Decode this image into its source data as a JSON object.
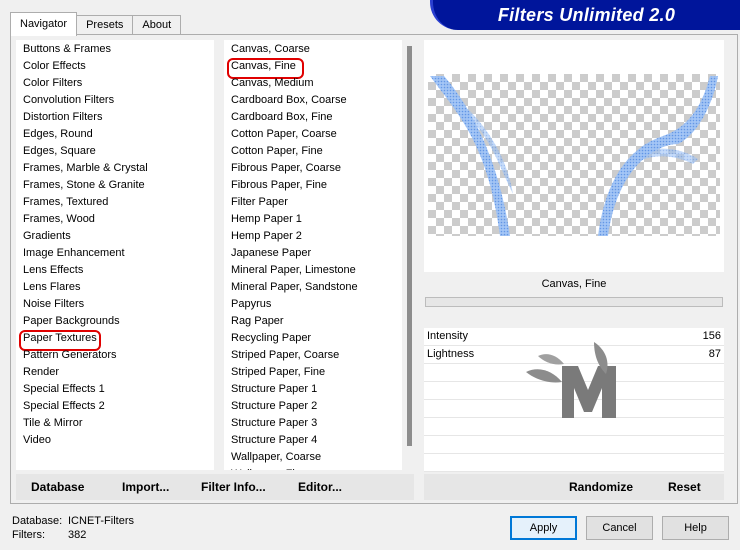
{
  "app": {
    "title": "Filters Unlimited 2.0"
  },
  "tabs": [
    {
      "label": "Navigator",
      "active": true
    },
    {
      "label": "Presets",
      "active": false
    },
    {
      "label": "About",
      "active": false
    }
  ],
  "categories": [
    "Buttons & Frames",
    "Color Effects",
    "Color Filters",
    "Convolution Filters",
    "Distortion Filters",
    "Edges, Round",
    "Edges, Square",
    "Frames, Marble & Crystal",
    "Frames, Stone & Granite",
    "Frames, Textured",
    "Frames, Wood",
    "Gradients",
    "Image Enhancement",
    "Lens Effects",
    "Lens Flares",
    "Noise Filters",
    "Paper Backgrounds",
    "Paper Textures",
    "Pattern Generators",
    "Render",
    "Special Effects 1",
    "Special Effects 2",
    "Tile & Mirror",
    "Video"
  ],
  "selected_category": "Paper Textures",
  "filters": [
    "Canvas, Coarse",
    "Canvas, Fine",
    "Canvas, Medium",
    "Cardboard Box, Coarse",
    "Cardboard Box, Fine",
    "Cotton Paper, Coarse",
    "Cotton Paper, Fine",
    "Fibrous Paper, Coarse",
    "Fibrous Paper, Fine",
    "Filter Paper",
    "Hemp Paper 1",
    "Hemp Paper 2",
    "Japanese Paper",
    "Mineral Paper, Limestone",
    "Mineral Paper, Sandstone",
    "Papyrus",
    "Rag Paper",
    "Recycling Paper",
    "Striped Paper, Coarse",
    "Striped Paper, Fine",
    "Structure Paper 1",
    "Structure Paper 2",
    "Structure Paper 3",
    "Structure Paper 4",
    "Wallpaper, Coarse",
    "Wallpaper, Fine"
  ],
  "selected_filter": "Canvas, Fine",
  "preview": {
    "filter_name": "Canvas, Fine"
  },
  "params": [
    {
      "name": "Intensity",
      "value": "156"
    },
    {
      "name": "Lightness",
      "value": "87"
    }
  ],
  "toolbar": {
    "database": "Database",
    "import": "Import...",
    "filter_info": "Filter Info...",
    "editor": "Editor...",
    "randomize": "Randomize",
    "reset": "Reset"
  },
  "status": {
    "database_label": "Database:",
    "database_value": "ICNET-Filters",
    "filters_label": "Filters:",
    "filters_value": "382"
  },
  "buttons": {
    "apply": "Apply",
    "cancel": "Cancel",
    "help": "Help"
  },
  "colors": {
    "banner": "#00159b",
    "highlight_circle": "#e00000",
    "default_button": "#0078d7"
  }
}
